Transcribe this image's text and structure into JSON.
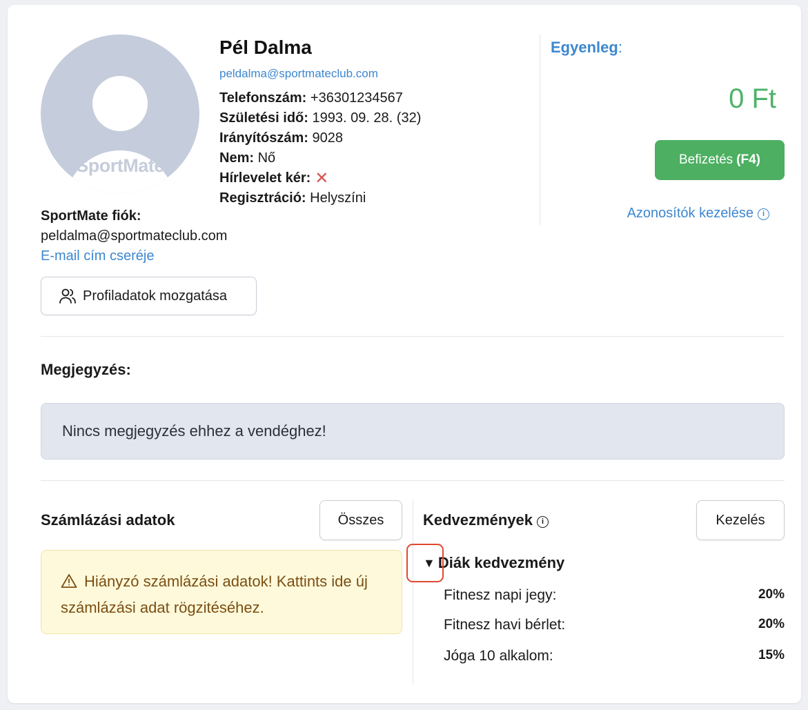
{
  "profile": {
    "avatar_brand": "SportMate",
    "name": "Pél Dalma",
    "email": "peldalma@sportmateclub.com",
    "phone_label": "Telefonszám:",
    "phone": "+36301234567",
    "birth_label": "Születési idő:",
    "birth": "1993. 09. 28. (32)",
    "zip_label": "Irányítószám:",
    "zip": "9028",
    "gender_label": "Nem:",
    "gender": "Nő",
    "newsletter_label": "Hírlevelet kér:",
    "newsletter_icon": "✕",
    "registration_label": "Regisztráció:",
    "registration": "Helyszíni"
  },
  "balance": {
    "label": "Egyenleg",
    "colon": ":",
    "amount": "0 Ft",
    "pay_label": "Befizetés",
    "pay_shortcut": "(F4)",
    "ids_link": "Azonosítók kezelése"
  },
  "account": {
    "label": "SportMate fiók:",
    "email": "peldalma@sportmateclub.com",
    "change_email": "E-mail cím cseréje",
    "move_button": "Profiladatok mozgatása"
  },
  "note": {
    "label": "Megjegyzés:",
    "text": "Nincs megjegyzés ehhez a vendéghez!"
  },
  "billing": {
    "title": "Számlázási adatok",
    "all_button": "Összes",
    "warning": "Hiányzó számlázási adatok! Kattints ide új számlázási adat rögzitéséhez."
  },
  "discounts": {
    "title": "Kedvezmények",
    "manage_button": "Kezelés",
    "group_caret": "▼",
    "group_name": "Diák kedvezmény",
    "items": [
      {
        "label": "Fitnesz napi jegy:",
        "value": "20%"
      },
      {
        "label": "Fitnesz havi bérlet:",
        "value": "20%"
      },
      {
        "label": "Jóga 10 alkalom:",
        "value": "15%"
      }
    ]
  },
  "colors": {
    "accent": "#3d87cf",
    "success": "#4caf61",
    "danger": "#d9534f",
    "warning_bg": "#fff9db",
    "highlight": "#e0492f"
  }
}
